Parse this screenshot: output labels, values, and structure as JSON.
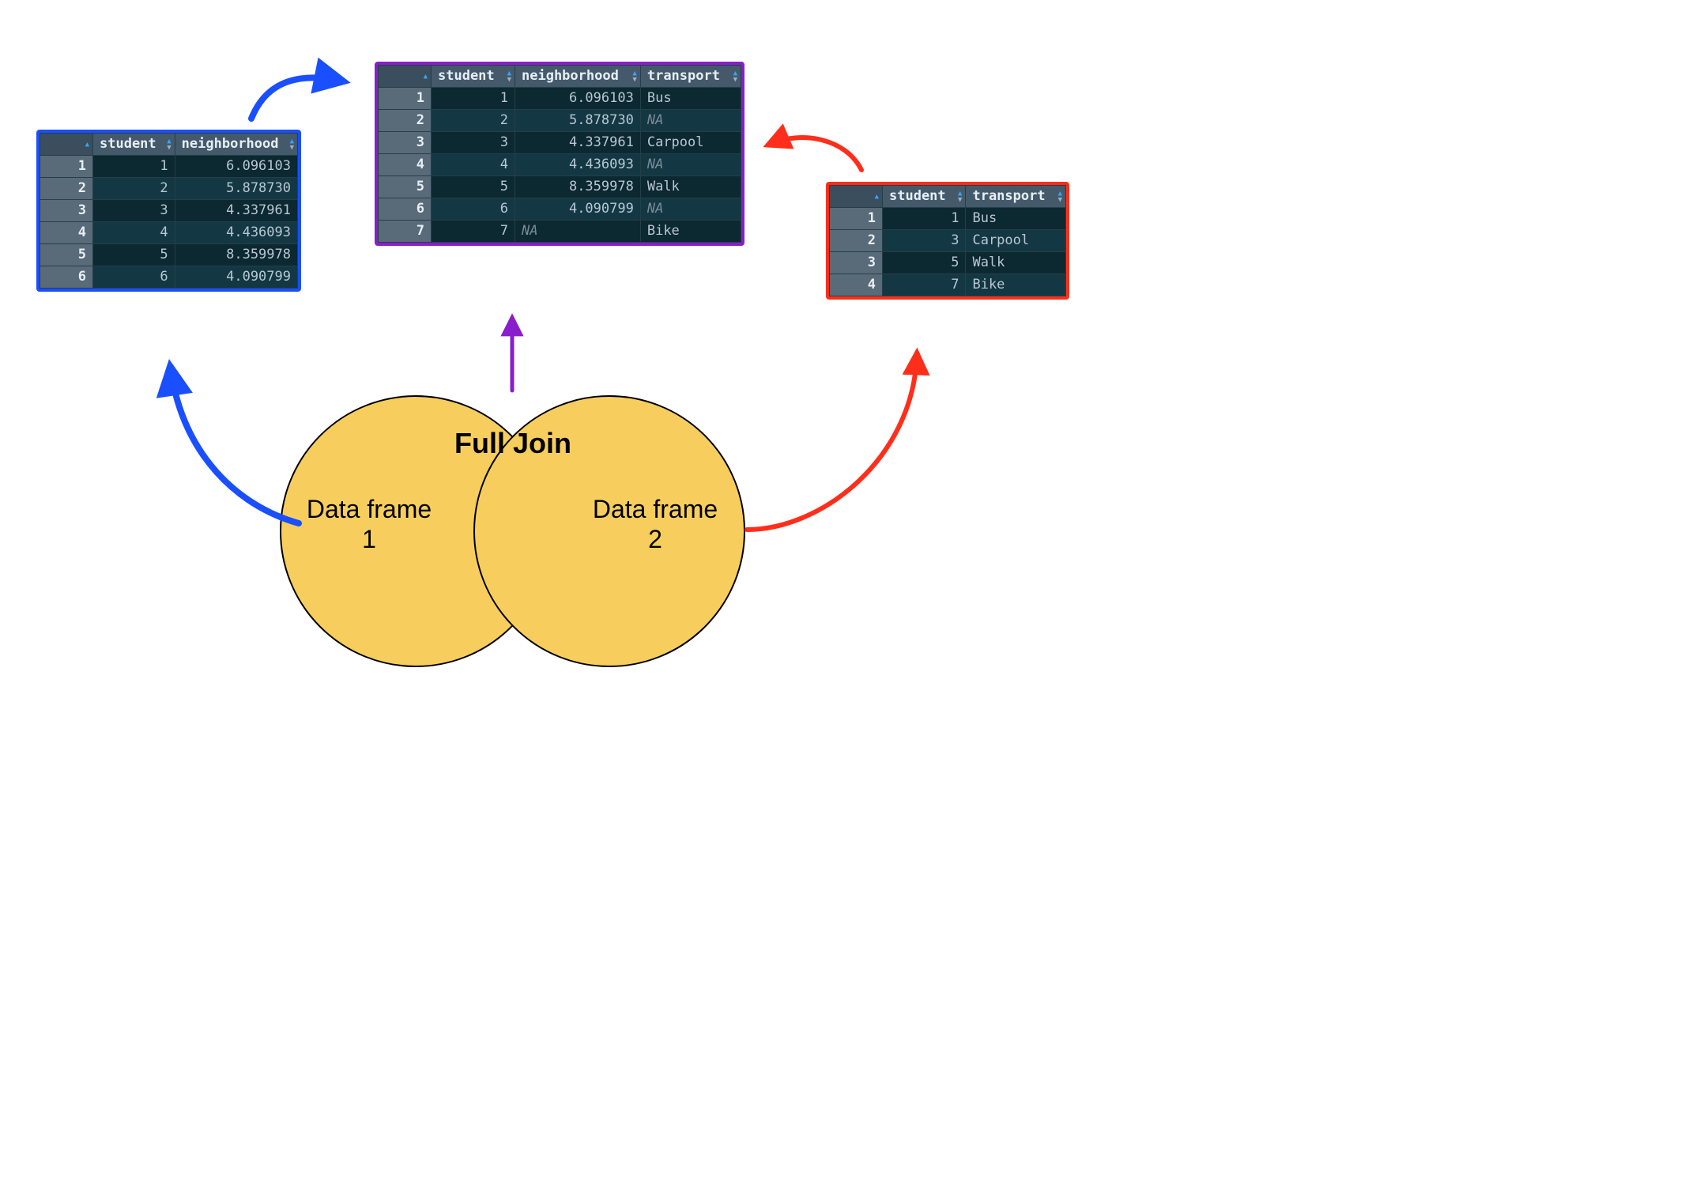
{
  "title_full_join": "Full Join",
  "venn": {
    "df1": "Data frame 1",
    "df2": "Data frame 2"
  },
  "df1": {
    "columns": {
      "idx": "",
      "c0": "student",
      "c1": "neighborhood"
    },
    "rows": [
      {
        "idx": "1",
        "student": "1",
        "neighborhood": "6.096103"
      },
      {
        "idx": "2",
        "student": "2",
        "neighborhood": "5.878730"
      },
      {
        "idx": "3",
        "student": "3",
        "neighborhood": "4.337961"
      },
      {
        "idx": "4",
        "student": "4",
        "neighborhood": "4.436093"
      },
      {
        "idx": "5",
        "student": "5",
        "neighborhood": "8.359978"
      },
      {
        "idx": "6",
        "student": "6",
        "neighborhood": "4.090799"
      }
    ]
  },
  "df2": {
    "columns": {
      "idx": "",
      "c0": "student",
      "c1": "transport"
    },
    "rows": [
      {
        "idx": "1",
        "student": "1",
        "transport": "Bus"
      },
      {
        "idx": "2",
        "student": "3",
        "transport": "Carpool"
      },
      {
        "idx": "3",
        "student": "5",
        "transport": "Walk"
      },
      {
        "idx": "4",
        "student": "7",
        "transport": "Bike"
      }
    ]
  },
  "result": {
    "columns": {
      "idx": "",
      "c0": "student",
      "c1": "neighborhood",
      "c2": "transport"
    },
    "rows": [
      {
        "idx": "1",
        "student": "1",
        "neighborhood": "6.096103",
        "transport": "Bus"
      },
      {
        "idx": "2",
        "student": "2",
        "neighborhood": "5.878730",
        "transport": "NA",
        "na_t": true
      },
      {
        "idx": "3",
        "student": "3",
        "neighborhood": "4.337961",
        "transport": "Carpool"
      },
      {
        "idx": "4",
        "student": "4",
        "neighborhood": "4.436093",
        "transport": "NA",
        "na_t": true
      },
      {
        "idx": "5",
        "student": "5",
        "neighborhood": "8.359978",
        "transport": "Walk"
      },
      {
        "idx": "6",
        "student": "6",
        "neighborhood": "4.090799",
        "transport": "NA",
        "na_t": true
      },
      {
        "idx": "7",
        "student": "7",
        "neighborhood": "NA",
        "na_n": true,
        "transport": "Bike"
      }
    ]
  },
  "chart_data": {
    "type": "table",
    "title": "Full Join of two data frames on `student`",
    "inputs": {
      "data_frame_1": {
        "columns": [
          "student",
          "neighborhood"
        ],
        "data": [
          [
            1,
            6.096103
          ],
          [
            2,
            5.87873
          ],
          [
            3,
            4.337961
          ],
          [
            4,
            4.436093
          ],
          [
            5,
            8.359978
          ],
          [
            6,
            4.090799
          ]
        ]
      },
      "data_frame_2": {
        "columns": [
          "student",
          "transport"
        ],
        "data": [
          [
            1,
            "Bus"
          ],
          [
            3,
            "Carpool"
          ],
          [
            5,
            "Walk"
          ],
          [
            7,
            "Bike"
          ]
        ]
      }
    },
    "output_full_join": {
      "columns": [
        "student",
        "neighborhood",
        "transport"
      ],
      "data": [
        [
          1,
          6.096103,
          "Bus"
        ],
        [
          2,
          5.87873,
          null
        ],
        [
          3,
          4.337961,
          "Carpool"
        ],
        [
          4,
          4.436093,
          null
        ],
        [
          5,
          8.359978,
          "Walk"
        ],
        [
          6,
          4.090799,
          null
        ],
        [
          7,
          null,
          "Bike"
        ]
      ]
    }
  }
}
